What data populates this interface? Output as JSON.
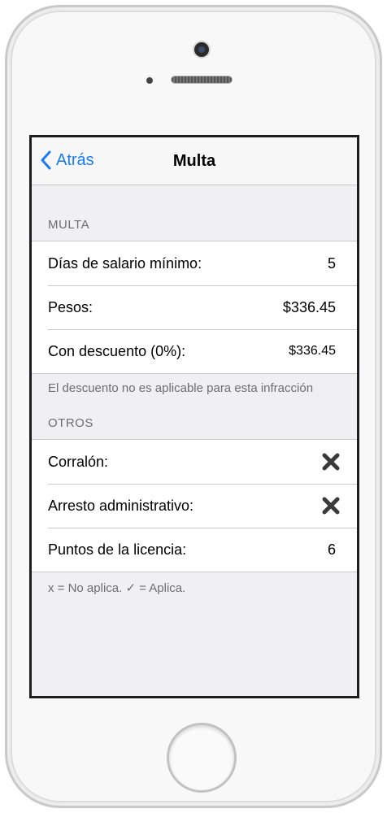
{
  "navbar": {
    "back_label": "Atrás",
    "title": "Multa"
  },
  "section_multa": {
    "header": "MULTA",
    "rows": [
      {
        "label": "Días de salario mínimo:",
        "value": "5"
      },
      {
        "label": "Pesos:",
        "value": "$336.45"
      },
      {
        "label": "Con descuento (0%):",
        "value": "$336.45"
      }
    ],
    "footer": "El descuento no es aplicable para esta infracción"
  },
  "section_otros": {
    "header": "OTROS",
    "rows": [
      {
        "label": "Corralón:",
        "icon": "x-icon"
      },
      {
        "label": "Arresto administrativo:",
        "icon": "x-icon"
      },
      {
        "label": "Puntos de la licencia:",
        "value": "6"
      }
    ],
    "footer": "x = No aplica. ✓ = Aplica."
  },
  "colors": {
    "accent": "#1a7cf5",
    "background": "#efeff4",
    "separator": "#c8c7cc",
    "secondary_text": "#6d6d72"
  }
}
